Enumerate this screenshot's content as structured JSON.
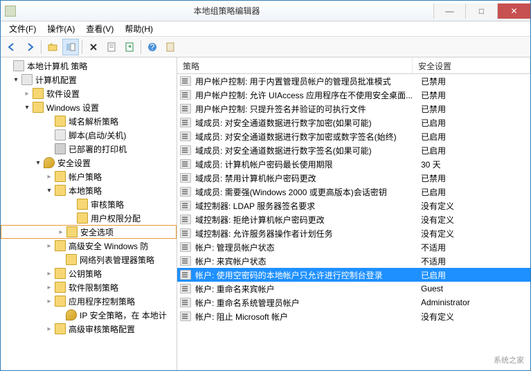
{
  "window": {
    "title": "本地组策略编辑器"
  },
  "win_btns": {
    "min": "—",
    "max": "□",
    "close": "✕"
  },
  "menu": {
    "file": "文件(F)",
    "action": "操作(A)",
    "view": "查看(V)",
    "help": "帮助(H)"
  },
  "tree": {
    "root": "本地计算机 策略",
    "computer_config": "计算机配置",
    "software_settings": "软件设置",
    "windows_settings": "Windows 设置",
    "dns_policy": "域名解析策略",
    "scripts": "脚本(启动/关机)",
    "printers": "已部署的打印机",
    "security_settings": "安全设置",
    "account_policy": "帐户策略",
    "local_policy": "本地策略",
    "audit_policy": "审核策略",
    "user_rights": "用户权限分配",
    "security_options": "安全选项",
    "windows_firewall": "高级安全 Windows 防",
    "network_list": "网络列表管理器策略",
    "pubkey_policy": "公钥策略",
    "software_restrict": "软件限制策略",
    "app_control": "应用程序控制策略",
    "ip_security": "IP 安全策略，在 本地计",
    "advanced_audit": "高级审核策略配置"
  },
  "list": {
    "headers": {
      "policy": "策略",
      "setting": "安全设置"
    },
    "rows": [
      {
        "policy": "用户帐户控制: 用于内置管理员帐户的管理员批准模式",
        "setting": "已禁用",
        "selected": false
      },
      {
        "policy": "用户帐户控制: 允许 UIAccess 应用程序在不使用安全桌面...",
        "setting": "已禁用",
        "selected": false
      },
      {
        "policy": "用户帐户控制: 只提升签名并验证的可执行文件",
        "setting": "已禁用",
        "selected": false
      },
      {
        "policy": "域成员: 对安全通道数据进行数字加密(如果可能)",
        "setting": "已启用",
        "selected": false
      },
      {
        "policy": "域成员: 对安全通道数据进行数字加密或数字签名(始终)",
        "setting": "已启用",
        "selected": false
      },
      {
        "policy": "域成员: 对安全通道数据进行数字签名(如果可能)",
        "setting": "已启用",
        "selected": false
      },
      {
        "policy": "域成员: 计算机帐户密码最长使用期限",
        "setting": "30 天",
        "selected": false
      },
      {
        "policy": "域成员: 禁用计算机帐户密码更改",
        "setting": "已禁用",
        "selected": false
      },
      {
        "policy": "域成员: 需要强(Windows 2000 或更高版本)会话密钥",
        "setting": "已启用",
        "selected": false
      },
      {
        "policy": "域控制器: LDAP 服务器签名要求",
        "setting": "没有定义",
        "selected": false
      },
      {
        "policy": "域控制器: 拒绝计算机帐户密码更改",
        "setting": "没有定义",
        "selected": false
      },
      {
        "policy": "域控制器: 允许服务器操作者计划任务",
        "setting": "没有定义",
        "selected": false
      },
      {
        "policy": "帐户: 管理员帐户状态",
        "setting": "不适用",
        "selected": false
      },
      {
        "policy": "帐户: 来宾帐户状态",
        "setting": "不适用",
        "selected": false
      },
      {
        "policy": "帐户: 使用空密码的本地帐户只允许进行控制台登录",
        "setting": "已启用",
        "selected": true
      },
      {
        "policy": "帐户: 重命名来宾帐户",
        "setting": "Guest",
        "selected": false
      },
      {
        "policy": "帐户: 重命名系统管理员帐户",
        "setting": "Administrator",
        "selected": false
      },
      {
        "policy": "帐户: 阻止 Microsoft 帐户",
        "setting": "没有定义",
        "selected": false
      }
    ]
  },
  "watermark": "系统之家"
}
